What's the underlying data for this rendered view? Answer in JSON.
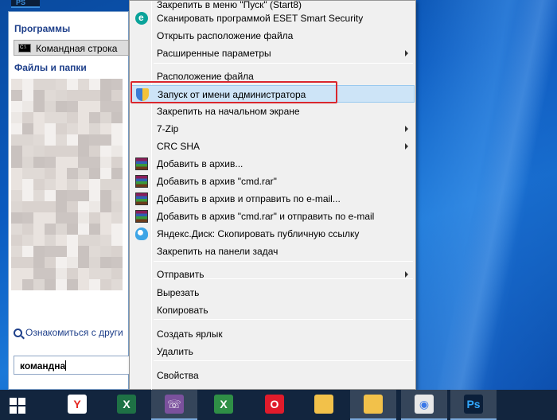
{
  "start_menu": {
    "programs_title": "Программы",
    "program_item": "Командная строка",
    "files_title": "Файлы и папки",
    "see_more": "Ознакомиться с други",
    "search_value": "командна"
  },
  "context_menu": {
    "items": [
      {
        "label": "Закрепить в меню \"Пуск\" (Start8)",
        "icon": "none"
      },
      {
        "label": "Сканировать программой ESET Smart Security",
        "icon": "eset-icon"
      },
      {
        "label": "Открыть расположение файла",
        "icon": "none"
      },
      {
        "label": "Расширенные параметры",
        "icon": "none",
        "submenu": true
      },
      {
        "label": "Расположение файла",
        "icon": "none"
      },
      {
        "label": "Запуск от имени администратора",
        "icon": "uac-shield-icon",
        "highlighted": true
      },
      {
        "label": "Закрепить на начальном экране",
        "icon": "none"
      },
      {
        "label": "7-Zip",
        "icon": "none",
        "submenu": true
      },
      {
        "label": "CRC SHA",
        "icon": "none",
        "submenu": true
      },
      {
        "label": "Добавить в архив...",
        "icon": "winrar-icon"
      },
      {
        "label": "Добавить в архив \"cmd.rar\"",
        "icon": "winrar-icon"
      },
      {
        "label": "Добавить в архив и отправить по e-mail...",
        "icon": "winrar-icon"
      },
      {
        "label": "Добавить в архив \"cmd.rar\" и отправить по e-mail",
        "icon": "winrar-icon"
      },
      {
        "label": "Яндекс.Диск: Скопировать публичную ссылку",
        "icon": "yandex-disk-icon"
      },
      {
        "label": "Закрепить на панели задач",
        "icon": "none"
      },
      {
        "label": "Отправить",
        "icon": "none",
        "submenu": true
      },
      {
        "label": "Вырезать",
        "icon": "none"
      },
      {
        "label": "Копировать",
        "icon": "none"
      },
      {
        "label": "Создать ярлык",
        "icon": "none"
      },
      {
        "label": "Удалить",
        "icon": "none"
      },
      {
        "label": "Свойства",
        "icon": "none"
      }
    ]
  },
  "taskbar": {
    "apps": [
      {
        "name": "yandex-browser-icon",
        "color": "#ffffff",
        "glyph": "Y",
        "glyph_color": "#e52620"
      },
      {
        "name": "excel-icon",
        "color": "#1e7145",
        "glyph": "X",
        "glyph_color": "#ffffff"
      },
      {
        "name": "viber-icon",
        "color": "#7b519d",
        "glyph": "☏",
        "glyph_color": "#ffffff",
        "active": true
      },
      {
        "name": "excel-sheet-icon",
        "color": "#2f8f46",
        "glyph": "X",
        "glyph_color": "#ffffff"
      },
      {
        "name": "opera-icon",
        "color": "#e01b2b",
        "glyph": "O",
        "glyph_color": "#ffffff"
      },
      {
        "name": "explorer-folder-icon",
        "color": "#f2c14a",
        "glyph": "",
        "glyph_color": "#ffffff"
      },
      {
        "name": "explorer-folder-icon",
        "color": "#f2c14a",
        "glyph": "",
        "glyph_color": "#ffffff",
        "active": true
      },
      {
        "name": "chrome-icon",
        "color": "#e8e8e8",
        "glyph": "◉",
        "glyph_color": "#3b78e7",
        "active": true
      },
      {
        "name": "photoshop-icon",
        "color": "#0b1f3a",
        "glyph": "Ps",
        "glyph_color": "#31a8ff",
        "active": true
      }
    ]
  },
  "colors": {
    "highlight_frame": "#d9272e",
    "menu_hover": "#cde4f7",
    "taskbar": "#12253e"
  }
}
